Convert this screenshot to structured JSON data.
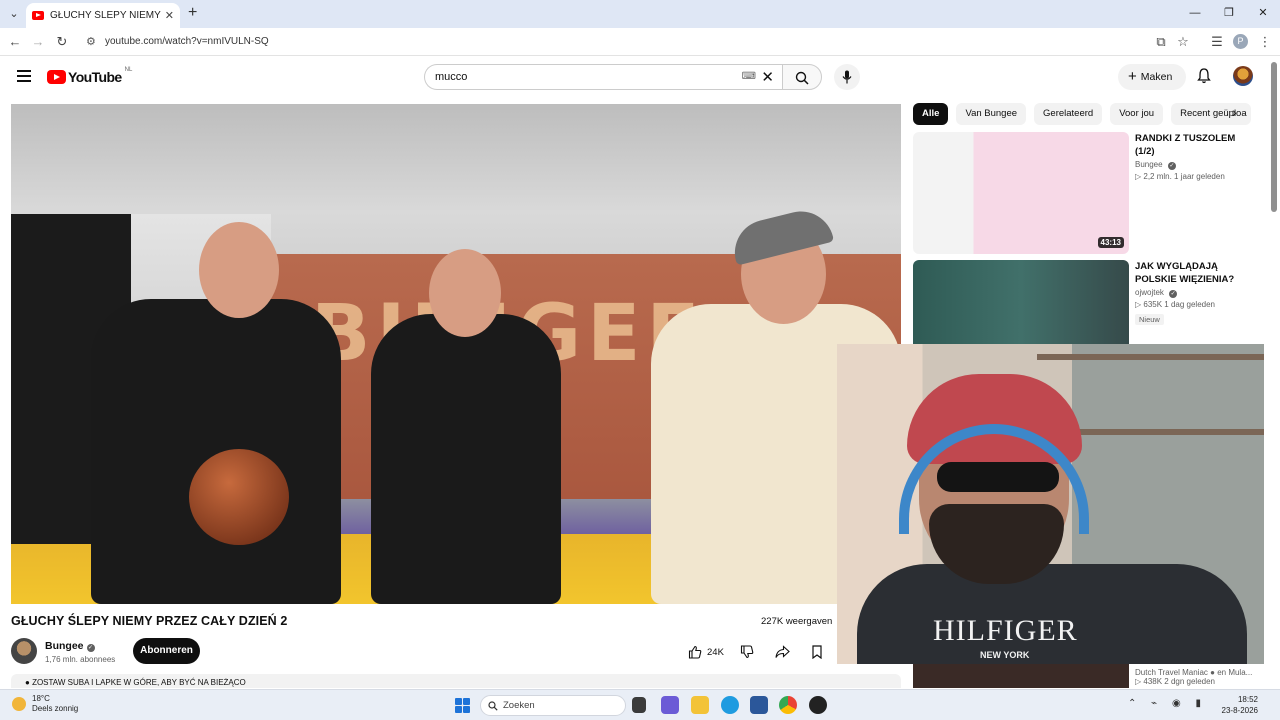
{
  "browser": {
    "tab_title": "GŁUCHY ŚLEPY NIEMY PRZEZ C",
    "url": "youtube.com/watch?v=nmIVULN-SQ"
  },
  "youtube": {
    "logo_text": "YouTube",
    "region": "NL",
    "search_query": "mucco",
    "create_label": "Maken"
  },
  "video": {
    "title": "GŁUCHY ŚLEPY NIEMY PRZEZ CAŁY DZIEŃ 2",
    "views": "227K weergaven",
    "scene_sign": "BUNGEE",
    "channel": {
      "name": "Bungee",
      "subscribers": "1,76 mln. abonnees"
    },
    "subscribe_label": "Abonneren",
    "likes": "24K",
    "description_preview": "ZOSTAW SUBA I LAPKE W GÓRE, ABY BYĆ NA BIEŻĄCO"
  },
  "sidebar": {
    "chips": [
      "Alle",
      "Van Bungee",
      "Gerelateerd",
      "Voor jou",
      "Recent geüploa"
    ],
    "recommendations": [
      {
        "title": "RANDKI Z TUSZOLEM (1/2)",
        "channel": "Bungee",
        "stats": "▷ 2,2 mln.   1 jaar geleden",
        "duration": "43:13",
        "badge": ""
      },
      {
        "title": "JAK WYGLĄDAJĄ POLSKIE WIĘZIENIA?",
        "channel": "ojwojtek",
        "stats": "▷ 635K   1 dag geleden",
        "duration": "",
        "badge": "Nieuw"
      }
    ],
    "partial_rec": {
      "channel": "Dutch Travel Maniac ● en Mula...",
      "stats": "▷ 438K   2 dgn geleden"
    }
  },
  "webcam": {
    "shirt_brand": "HILFIGER",
    "shirt_sub": "NEW YORK"
  },
  "taskbar": {
    "temperature": "18°C",
    "condition": "Deels zonnig",
    "search_placeholder": "Zoeken",
    "time": "18:52",
    "date": "23-8-2026"
  }
}
